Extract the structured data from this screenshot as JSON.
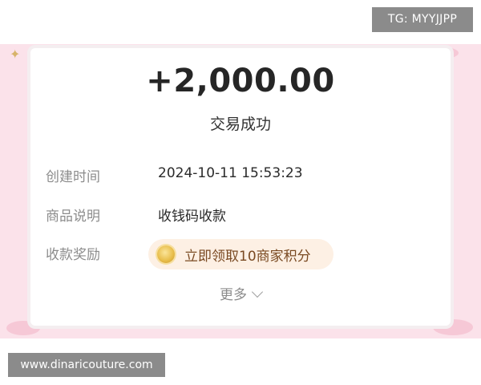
{
  "overlay": {
    "top_badge": "TG: MYYJJPP",
    "bottom_watermark": "www.dinaricouture.com"
  },
  "receipt": {
    "amount": "+2,000.00",
    "status": "交易成功",
    "rows": [
      {
        "label": "创建时间",
        "value": "2024-10-11 15:53:23"
      },
      {
        "label": "商品说明",
        "value": "收钱码收款"
      },
      {
        "label": "收款奖励",
        "value": "立即领取10商家积分"
      }
    ],
    "more": "更多"
  },
  "colors": {
    "background_band": "#fbe2ea",
    "card": "#ffffff",
    "reward_pill": "#fdf0e4",
    "reward_text": "#7a4a22",
    "label_gray": "#8c8c8c"
  },
  "icons": {
    "reward": "coin-icon",
    "more": "chevron-down-icon"
  }
}
